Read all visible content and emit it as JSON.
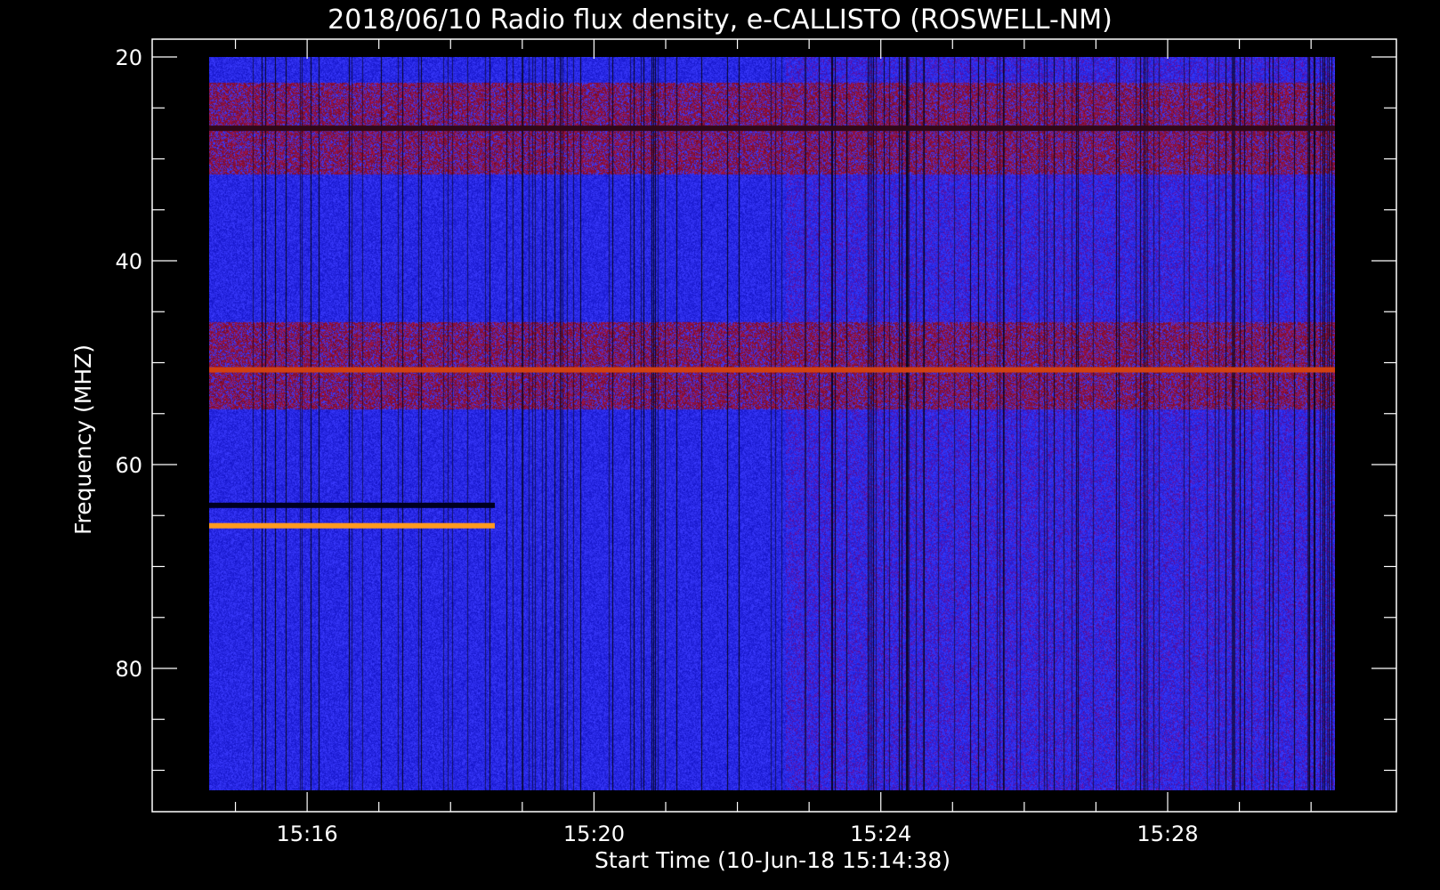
{
  "chart_data": {
    "type": "heatmap",
    "title": "2018/06/10  Radio flux density, e-CALLISTO (ROSWELL-NM)",
    "xlabel": "Start Time (10-Jun-18 15:14:38)",
    "ylabel": "Frequency (MHZ)",
    "x_ticks": [
      "15:16",
      "15:20",
      "15:24",
      "15:28"
    ],
    "y_ticks": [
      "20",
      "40",
      "60",
      "80"
    ],
    "x_range": [
      "15:14:38",
      "15:30:20"
    ],
    "y_range": [
      20,
      92
    ],
    "y_axis": "frequency increasing downward",
    "colormap": [
      "#000000",
      "#0000cc",
      "#2828ff",
      "#8a1a2a",
      "#c81e1e",
      "#ff7a00",
      "#ffff40"
    ],
    "background_level": "blue",
    "bands": [
      {
        "freq": [
          22.5,
          31.5
        ],
        "level": "elevated (red)"
      },
      {
        "freq": [
          46.0,
          54.5
        ],
        "level": "elevated (red)"
      }
    ],
    "interference_lines": [
      {
        "freq": 27.0,
        "start": "15:14:38",
        "end": "15:30:20",
        "level": "dark/red"
      },
      {
        "freq": 50.7,
        "start": "15:14:38",
        "end": "15:30:20",
        "level": "yellow/red"
      },
      {
        "freq": 64.0,
        "start": "15:14:38",
        "end": "15:18:37",
        "level": "dark"
      },
      {
        "freq": 66.0,
        "start": "15:14:38",
        "end": "15:18:37",
        "level": "orange"
      }
    ]
  }
}
